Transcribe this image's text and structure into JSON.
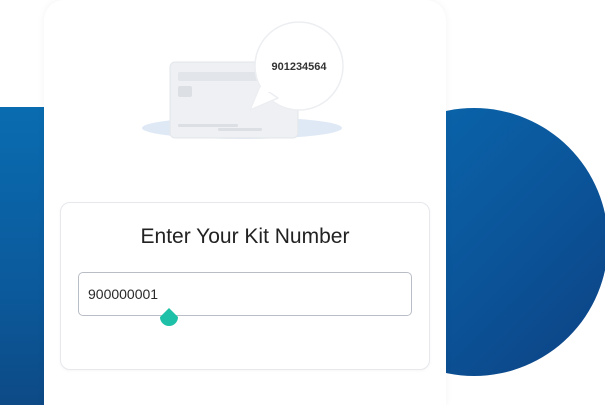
{
  "illustration": {
    "bubble_number": "901234564"
  },
  "kit_form": {
    "title": "Enter Your Kit Number",
    "input_value": "900000001"
  },
  "colors": {
    "brand_blue": "#0b5a9c",
    "handle_teal": "#1ec1a8"
  }
}
